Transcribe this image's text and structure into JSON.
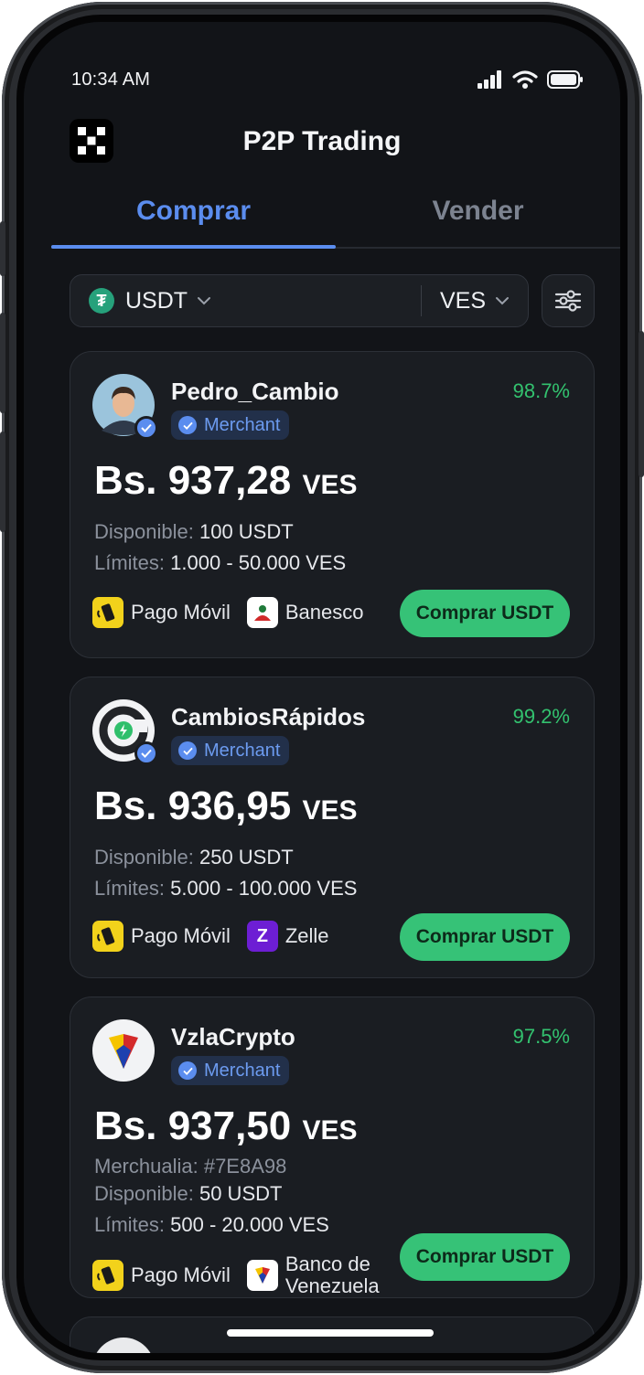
{
  "status": {
    "time": "10:34 AM"
  },
  "header": {
    "title": "P2P Trading"
  },
  "tabs": [
    {
      "label": "Comprar",
      "active": true
    },
    {
      "label": "Vender",
      "active": false
    }
  ],
  "filters": {
    "crypto": "USDT",
    "fiat": "VES",
    "crypto_icon": "tether-icon",
    "filter_icon": "sliders-icon"
  },
  "colors": {
    "accent": "#5b8def",
    "positive": "#33c26f",
    "buy_button": "#36c277",
    "background": "#121418"
  },
  "offers": [
    {
      "name": "Pedro_Cambio",
      "badge": "Merchant",
      "rate": "98.7%",
      "price_prefix": "Bs. 937,28",
      "price_currency": "VES",
      "available_label": "Disponible:",
      "available": "100 USDT",
      "limits_label": "Límites:",
      "limits": "1.000 - 50.000 VES",
      "methods": [
        {
          "name": "Pago Móvil",
          "icon": "pago-movil-icon"
        },
        {
          "name": "Banesco",
          "icon": "banesco-icon"
        }
      ],
      "button": "Comprar USDT"
    },
    {
      "name": "CambiosRápidos",
      "badge": "Merchant",
      "rate": "99.2%",
      "price_prefix": "Bs. 936,95",
      "price_currency": "VES",
      "available_label": "Disponible:",
      "available": "250 USDT",
      "limits_label": "Límites:",
      "limits": "5.000 - 100.000 VES",
      "methods": [
        {
          "name": "Pago Móvil",
          "icon": "pago-movil-icon"
        },
        {
          "name": "Zelle",
          "icon": "zelle-icon"
        }
      ],
      "button": "Comprar USDT"
    },
    {
      "name": "VzlaCrypto",
      "badge": "Merchant",
      "rate": "97.5%",
      "price_prefix": "Bs. 937,50",
      "price_currency": "VES",
      "extra": "Merchualia: #7E8A98",
      "available_label": "Disponible:",
      "available": "50 USDT",
      "limits_label": "Límites:",
      "limits": "500 - 20.000 VES",
      "methods": [
        {
          "name": "Pago Móvil",
          "icon": "pago-movil-icon"
        },
        {
          "name": "Banco de Venezuela",
          "name_line1": "Banco de",
          "name_line2": "Venezuela",
          "icon": "banco-venezuela-icon"
        }
      ],
      "button": "Comprar USDT"
    }
  ]
}
